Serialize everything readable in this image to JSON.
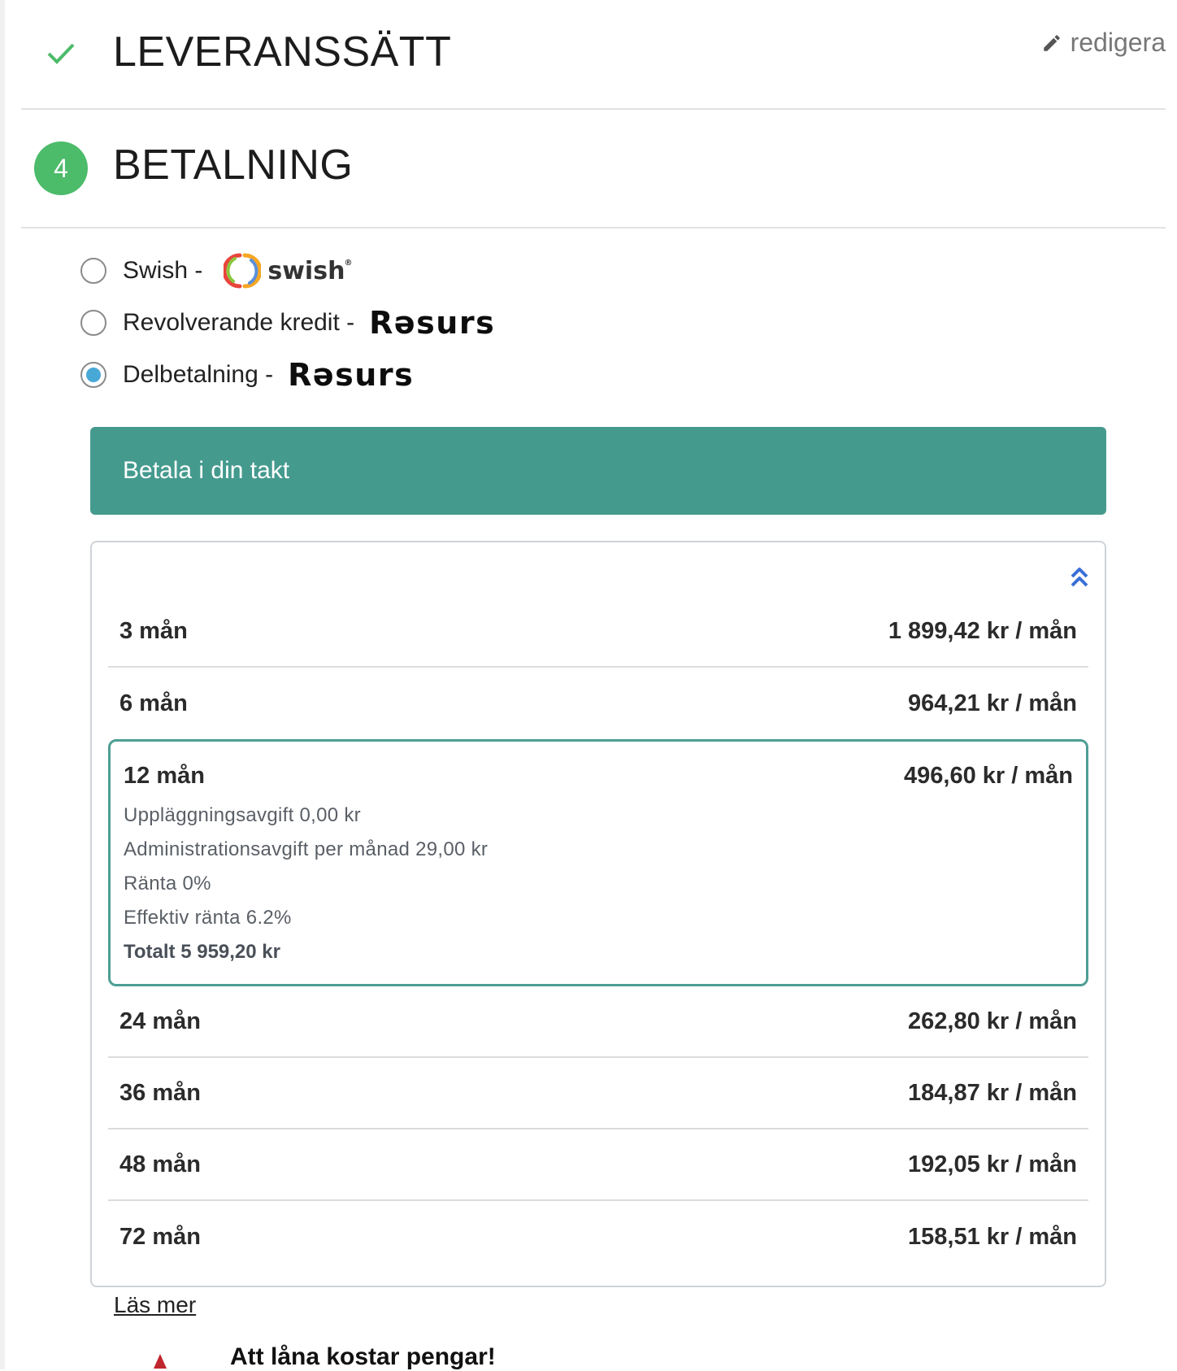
{
  "sections": {
    "delivery": {
      "title": "LEVERANSSÄTT",
      "edit_label": "redigera"
    },
    "payment": {
      "title": "BETALNING",
      "step_number": "4"
    }
  },
  "payment_options": [
    {
      "label": "Swish -",
      "brand": "swish",
      "selected": false
    },
    {
      "label": "Revolverande kredit -",
      "brand": "Resurs",
      "selected": false
    },
    {
      "label": "Delbetalning -",
      "brand": "Resurs",
      "selected": true
    }
  ],
  "logos": {
    "swish_text": "swish",
    "swish_reg": "®",
    "resurs_text": "Rəsurs"
  },
  "banner": {
    "text": "Betala i din takt"
  },
  "plans": [
    {
      "term": "3 mån",
      "price": "1 899,42 kr / mån"
    },
    {
      "term": "6 mån",
      "price": "964,21 kr / mån"
    },
    {
      "term": "12 mån",
      "price": "496,60 kr / mån",
      "details": {
        "setup_fee": "Uppläggningsavgift 0,00 kr",
        "admin_fee": "Administrationsavgift per månad 29,00 kr",
        "interest": "Ränta 0%",
        "effective_interest": "Effektiv ränta 6.2%",
        "total": "Totalt 5 959,20 kr"
      }
    },
    {
      "term": "24 mån",
      "price": "262,80 kr / mån"
    },
    {
      "term": "36 mån",
      "price": "184,87 kr / mån"
    },
    {
      "term": "48 mån",
      "price": "192,05 kr / mån"
    },
    {
      "term": "72 mån",
      "price": "158,51 kr / mån"
    }
  ],
  "read_more": "Läs mer",
  "warning": "Att låna kostar pengar!",
  "colors": {
    "accent_teal": "#459a8e",
    "step_green": "#4cbb6a",
    "radio_blue": "#48a8d6",
    "chevron_blue": "#3a6fd8",
    "warning_red": "#c0262d"
  }
}
